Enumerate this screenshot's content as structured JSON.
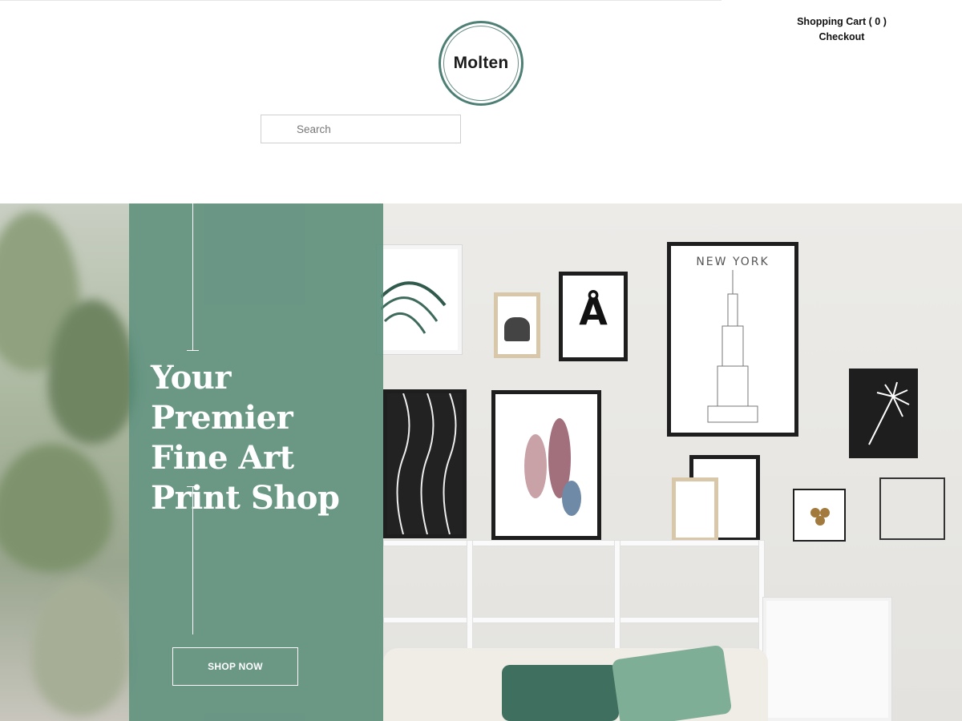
{
  "header": {
    "cart_label": "Shopping Cart ( 0 )",
    "checkout_label": "Checkout",
    "logo_text": "Molten",
    "search": {
      "placeholder": "Search",
      "value": ""
    }
  },
  "hero": {
    "headline": "Your Premier Fine Art Print Shop",
    "cta_label": "SHOP NOW",
    "panel_color": "#5f8f7c",
    "artwork": {
      "poster_city": "NEW YORK",
      "poster_letter": "Å"
    }
  },
  "colors": {
    "accent": "#4d7f75",
    "text": "#111111",
    "panel": "#5f8f7c"
  }
}
